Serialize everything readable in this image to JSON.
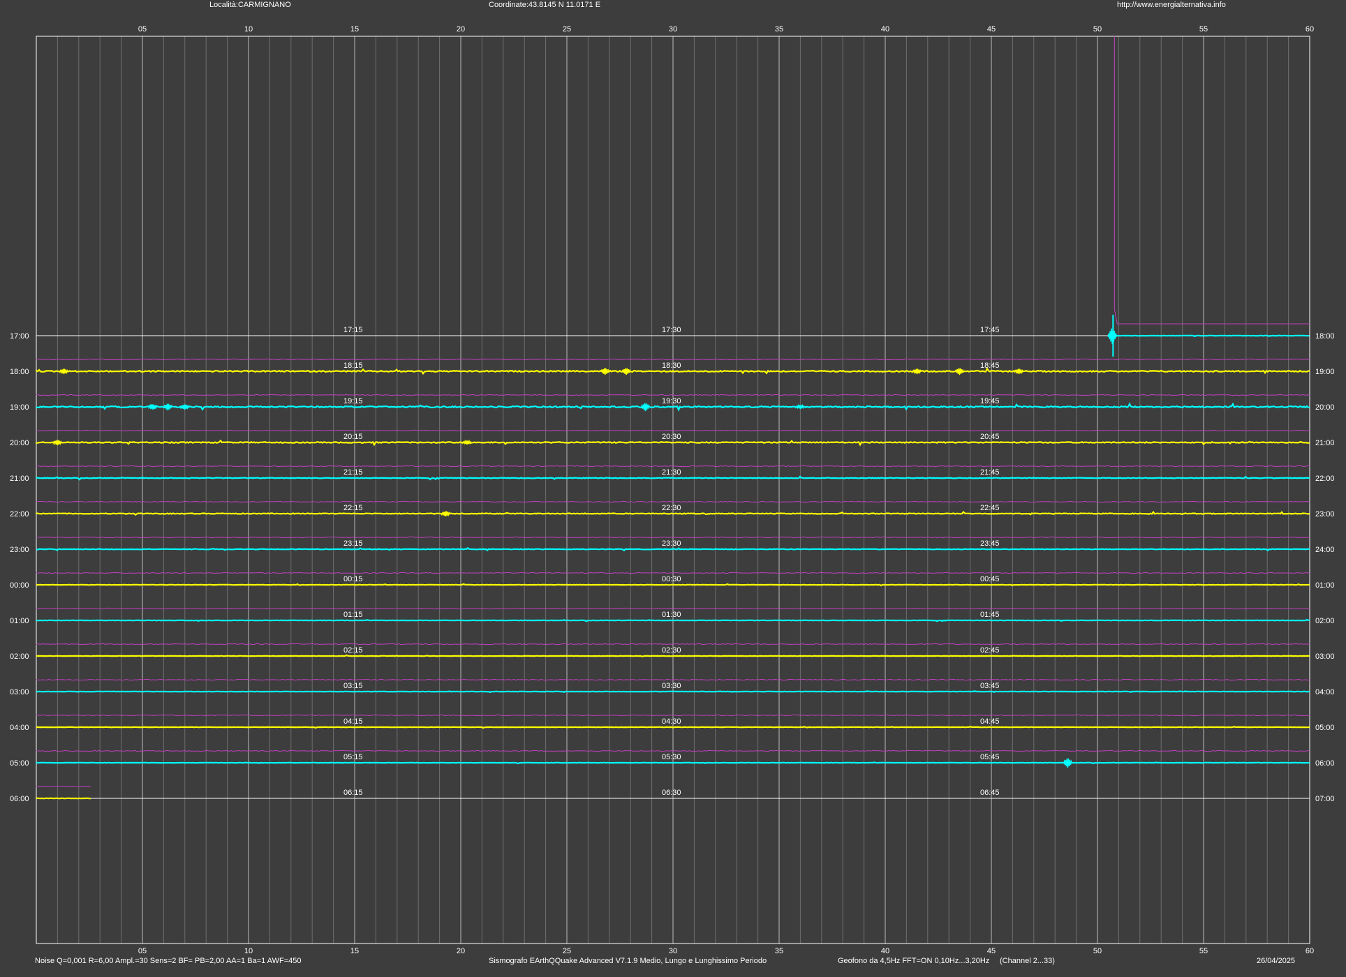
{
  "header": {
    "location": "Località:CARMIGNANO",
    "coordinates": "Coordinate:43.8145 N 11.0171 E",
    "website": "http://www.energialternativa.info"
  },
  "footer": {
    "params": "Noise Q=0,001 R=6,00 Ampl.=30 Sens=2 BF= PB=2,00 AA=1 Ba=1 AWF=450",
    "software": "Sismografo  EArthQQuake Advanced V7.1.9  Medio, Lungo e Lunghissimo Periodo",
    "sensor": "Geofono da 4,5Hz FFT=ON 0,10Hz...3,20Hz",
    "channel": "(Channel 2...33)",
    "date": "26/04/2025"
  },
  "colors": {
    "background": "#3d3d3d",
    "grid": "#8c8c8c",
    "border": "#ffffff",
    "yellow": "#ffff00",
    "cyan": "#00ffff",
    "magenta": "#c040c0"
  },
  "chart_data": {
    "type": "line",
    "x_ticks": [
      "05",
      "10",
      "15",
      "20",
      "25",
      "30",
      "35",
      "40",
      "45",
      "50",
      "55",
      "60"
    ],
    "xlim": [
      0,
      60
    ],
    "left_labels": [
      "17:00",
      "18:00",
      "19:00",
      "20:00",
      "21:00",
      "22:00",
      "23:00",
      "00:00",
      "01:00",
      "02:00",
      "03:00",
      "04:00",
      "05:00",
      "06:00"
    ],
    "right_labels": [
      "18:00",
      "19:00",
      "20:00",
      "21:00",
      "22:00",
      "23:00",
      "24:00",
      "01:00",
      "02:00",
      "03:00",
      "04:00",
      "05:00",
      "06:00",
      "07:00"
    ],
    "inline_labels": [
      [
        "17:15",
        "17:30",
        "17:45"
      ],
      [
        "18:15",
        "18:30",
        "18:45"
      ],
      [
        "19:15",
        "19:30",
        "19:45"
      ],
      [
        "20:15",
        "20:30",
        "20:45"
      ],
      [
        "21:15",
        "21:30",
        "21:45"
      ],
      [
        "22:15",
        "22:30",
        "22:45"
      ],
      [
        "23:15",
        "23:30",
        "23:45"
      ],
      [
        "00:15",
        "00:30",
        "00:45"
      ],
      [
        "01:15",
        "01:30",
        "01:45"
      ],
      [
        "02:15",
        "02:30",
        "02:45"
      ],
      [
        "03:15",
        "03:30",
        "03:45"
      ],
      [
        "04:15",
        "04:30",
        "04:45"
      ],
      [
        "05:15",
        "05:30",
        "05:45"
      ],
      [
        "06:15",
        "06:30",
        "06:45"
      ]
    ],
    "inline_label_minutes": [
      15,
      30,
      45
    ],
    "trace_colors": [
      "cyan",
      "yellow",
      "cyan",
      "yellow",
      "cyan",
      "yellow",
      "cyan",
      "yellow",
      "cyan",
      "yellow",
      "cyan",
      "yellow",
      "cyan",
      "yellow"
    ],
    "trace_start_min": [
      50.7,
      0,
      0,
      0,
      0,
      0,
      0,
      0,
      0,
      0,
      0,
      0,
      0,
      0
    ],
    "trace_end_min": [
      60,
      60,
      60,
      60,
      60,
      60,
      60,
      60,
      60,
      60,
      60,
      60,
      60,
      2.6
    ],
    "noise_level": [
      0.6,
      1.6,
      1.8,
      1.4,
      0.9,
      1.0,
      0.8,
      0.5,
      0.5,
      0.4,
      0.4,
      0.4,
      0.4,
      0.4
    ],
    "events": [
      {
        "row": 0,
        "min": 50.7,
        "amp": 12
      },
      {
        "row": 1,
        "min": 1.3,
        "amp": 4
      },
      {
        "row": 1,
        "min": 26.8,
        "amp": 5
      },
      {
        "row": 1,
        "min": 27.8,
        "amp": 5
      },
      {
        "row": 1,
        "min": 41.5,
        "amp": 4
      },
      {
        "row": 1,
        "min": 43.5,
        "amp": 5
      },
      {
        "row": 1,
        "min": 46.3,
        "amp": 4
      },
      {
        "row": 2,
        "min": 5.5,
        "amp": 4
      },
      {
        "row": 2,
        "min": 6.2,
        "amp": 5
      },
      {
        "row": 2,
        "min": 7.0,
        "amp": 4
      },
      {
        "row": 2,
        "min": 28.7,
        "amp": 6
      },
      {
        "row": 2,
        "min": 36.0,
        "amp": 3
      },
      {
        "row": 3,
        "min": 1.0,
        "amp": 4
      },
      {
        "row": 3,
        "min": 20.3,
        "amp": 3
      },
      {
        "row": 5,
        "min": 19.3,
        "amp": 4
      },
      {
        "row": 12,
        "min": 48.6,
        "amp": 7
      }
    ],
    "spike_magenta": {
      "row": 0,
      "min": 50.8,
      "level_min": 51.0
    }
  }
}
